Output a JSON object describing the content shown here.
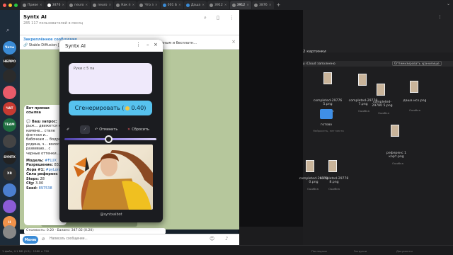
{
  "browser": {
    "tabs": [
      {
        "label": "Приве"
      },
      {
        "label": "3876"
      },
      {
        "label": "neuro"
      },
      {
        "label": "neuro"
      },
      {
        "label": "Как п"
      },
      {
        "label": "Что з"
      },
      {
        "label": "001 Б"
      },
      {
        "label": "Даша"
      },
      {
        "label": "3912"
      },
      {
        "label": "3912"
      },
      {
        "label": "3876"
      }
    ],
    "new_tab": "+"
  },
  "chat": {
    "title": "Syntx AI",
    "subtitle": "285 117 пользователей в месяц",
    "pinned_title": "Закреплённое сообщение",
    "pinned_text": "🔗 Stable Diffusion [BETA]",
    "pinned_right": "максимально доступным и бесплатн...",
    "folders": [
      {
        "label": "Чаты",
        "color": "#3a8bd6"
      },
      {
        "label": "НЕЙРО",
        "color": "#222"
      },
      {
        "label": "",
        "color": "#2b2b2b"
      },
      {
        "label": "",
        "color": "#e95b6a"
      },
      {
        "label": "ЧАТ",
        "color": "#c73a32"
      },
      {
        "label": "TEAM",
        "color": "#1f6e40"
      },
      {
        "label": "",
        "color": "#444"
      },
      {
        "label": "SYNTX",
        "color": "#222"
      },
      {
        "label": "XR",
        "color": "#333"
      },
      {
        "label": "",
        "color": "#4b7fd0"
      },
      {
        "label": "",
        "color": "#8a5cd6"
      },
      {
        "label": "Н",
        "color": "#f1924a"
      },
      {
        "label": "",
        "color": "#888"
      }
    ],
    "message": {
      "intro": "Вот прямая ссылка",
      "q_label": "Ваш запрос:",
      "q_text": "рыж... движется к в камене... стиле фэнтэзи и... бабочкам ... бодро родина, ч... волосы развеваю... с черные оттенки...",
      "model_label": "Модель:",
      "model": "#FLUX",
      "res_label": "Разрешение:",
      "res": "832",
      "lora_label": "Лора #1:",
      "lora": "#pyLora",
      "ref_label": "Сила референс",
      "steps_label": "Steps:",
      "steps": "28",
      "cfg_label": "Cfg:",
      "cfg": "3.00",
      "seed_label": "Seed:",
      "seed": "897538",
      "bottom": "Стоимость: 0.20 · Баланс: 347.02 (0.20)"
    },
    "composer": {
      "menu_label": "Меню",
      "placeholder": "Написать сообщение..."
    }
  },
  "popup": {
    "title": "Syntx AI",
    "prompt_text": "Руки с 5 па",
    "generate_label": "Сгенерировать (",
    "generate_cost": "0.40)",
    "undo_label": "Отменить",
    "reset_label": "Сбросить",
    "watermark": "@syntxaibot"
  },
  "finder": {
    "section_label": "2 картинки",
    "icloud_label": "у iCloud заполнено",
    "optimize_label": "Оптимизировать хранилище",
    "files": [
      {
        "name": "completed-29776 5.png",
        "err": "Ошибка"
      },
      {
        "name": "completed-29778 7.png",
        "err": "Ошибка"
      },
      {
        "name": "completed-29780 5.png",
        "err": "Ошибка"
      },
      {
        "name": "даша исх.png",
        "err": "Ошибка"
      },
      {
        "name": "референс 1 карт.png",
        "err": "Ошибка"
      },
      {
        "name": "completed-29778 0.png",
        "err": "Ошибка"
      },
      {
        "name": "completed-29778 8.png",
        "err": "Ошибка"
      }
    ],
    "folder_label": "готово",
    "folder_sub": "Нейросеть, нет места"
  },
  "status": {
    "left": "1 файл, 4.1 МБ (0 Б) · 1280 × 720",
    "right1": "Последние",
    "right2": "Загрузки",
    "right3": "Документы"
  }
}
